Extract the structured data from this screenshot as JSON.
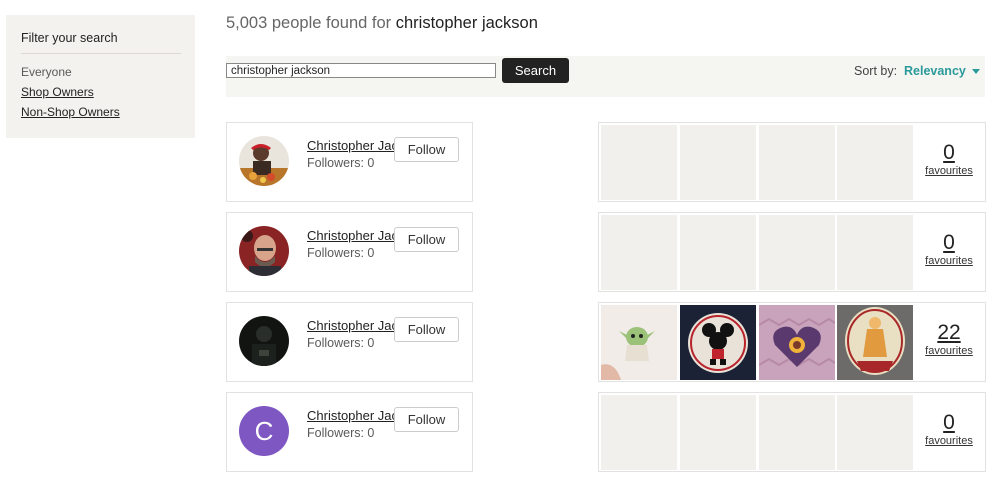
{
  "sidebar": {
    "title": "Filter your search",
    "filters": [
      "Everyone",
      "Shop Owners",
      "Non-Shop Owners"
    ]
  },
  "header": {
    "count_text": "5,003 people found for",
    "query": "christopher jackson"
  },
  "search": {
    "value": "christopher jackson",
    "button_label": "Search",
    "sort_label": "Sort by:",
    "sort_value": "Relevancy"
  },
  "results": [
    {
      "name": "Christopher Jackson",
      "followers": "Followers: 0",
      "follow_label": "Follow",
      "favourites_count": "0",
      "favourites_label": "favourites"
    },
    {
      "name": "Christopher Jackson",
      "followers": "Followers: 0",
      "follow_label": "Follow",
      "favourites_count": "0",
      "favourites_label": "favourites"
    },
    {
      "name": "Christopher Jackson",
      "followers": "Followers: 0",
      "follow_label": "Follow",
      "favourites_count": "22",
      "favourites_label": "favourites"
    },
    {
      "name": "Christopher Jackson",
      "followers": "Followers: 0",
      "follow_label": "Follow",
      "favourites_count": "0",
      "favourites_label": "favourites",
      "avatar_letter": "C"
    }
  ],
  "colors": {
    "accent": "#2a9a9a",
    "sidebar_bg": "#f3f2ee",
    "avatar_letter_bg": "#7e57c2"
  }
}
